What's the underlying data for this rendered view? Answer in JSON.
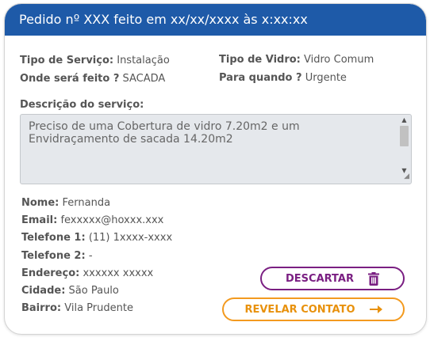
{
  "header": {
    "title": "Pedido nº XXX feito em xx/xx/xxxx às x:xx:xx"
  },
  "details": {
    "tipo_servico_label": "Tipo de Serviço:",
    "tipo_servico_value": "Instalação",
    "onde_label": "Onde será feito ?",
    "onde_value": "SACADA",
    "tipo_vidro_label": "Tipo de Vidro:",
    "tipo_vidro_value": "Vidro Comum",
    "quando_label": "Para quando ?",
    "quando_value": "Urgente"
  },
  "description": {
    "label": "Descrição do serviço:",
    "text": "Preciso de uma Cobertura de vidro 7.20m2 e um Envidraçamento de sacada 14.20m2"
  },
  "contact": {
    "nome_label": "Nome:",
    "nome_value": "Fernanda",
    "email_label": "Email:",
    "email_value": "fexxxxx@hoxxx.xxx",
    "tel1_label": "Telefone 1:",
    "tel1_value": "(11) 1xxxx-xxxx",
    "tel2_label": "Telefone 2:",
    "tel2_value": "-",
    "endereco_label": "Endereço:",
    "endereco_value": "xxxxxx xxxxx",
    "cidade_label": "Cidade:",
    "cidade_value": "São Paulo",
    "bairro_label": "Bairro:",
    "bairro_value": "Vila Prudente"
  },
  "actions": {
    "discard_label": "DESCARTAR",
    "discard_icon": "trash-icon",
    "reveal_label": "REVELAR CONTATO",
    "reveal_icon": "arrow-right-icon",
    "discard_color": "#7a1f82",
    "reveal_color": "#f39a1f"
  },
  "colors": {
    "header_bg": "#1e5aa8",
    "textarea_bg": "#e5e8ec"
  }
}
